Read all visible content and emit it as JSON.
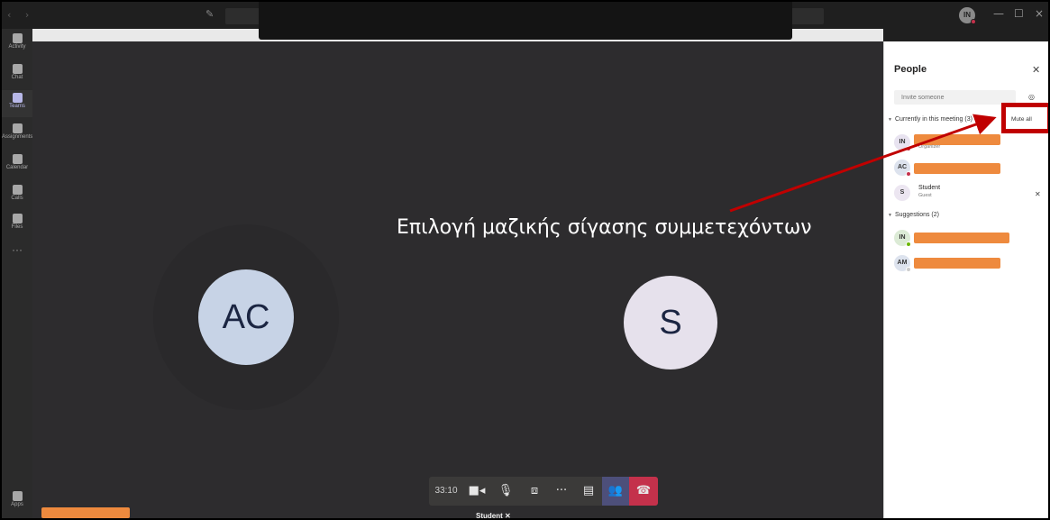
{
  "titlebar": {
    "nav_arrows": "‹ ›",
    "avatar_initials": "IN",
    "window_controls": {
      "minimize": "—",
      "maximize": "☐",
      "close": "×"
    }
  },
  "rail": {
    "items": [
      {
        "label": "Activity"
      },
      {
        "label": "Chat"
      },
      {
        "label": "Teams"
      },
      {
        "label": "Assignments"
      },
      {
        "label": "Calendar"
      },
      {
        "label": "Calls"
      },
      {
        "label": "Files"
      }
    ],
    "more": "···",
    "apps": "Apps"
  },
  "stage": {
    "tiles": [
      {
        "initials": "AC"
      },
      {
        "initials": "S"
      }
    ],
    "annotation": "Επιλογή μαζικής σίγασης συμμετεχόντων"
  },
  "controls": {
    "timer": "33:10",
    "icons": [
      "camera-icon",
      "microphone-icon",
      "share-screen-icon",
      "more-icon",
      "chat-icon",
      "participants-icon",
      "hang-up-icon"
    ],
    "self_label": "Student"
  },
  "people_panel": {
    "title": "People",
    "invite_placeholder": "Invite someone",
    "current_section": "Currently in this meeting (3)",
    "mute_all": "Mute all",
    "participants": [
      {
        "initials": "IN",
        "role": "Organizer",
        "status_color": "#c4314b"
      },
      {
        "initials": "AC",
        "role": "",
        "status_color": "#c4314b"
      },
      {
        "initials": "S",
        "name": "Student",
        "role": "Guest"
      }
    ],
    "suggestions_section": "Suggestions (2)",
    "suggestions": [
      {
        "initials": "IN",
        "status_color": "#6bb700"
      },
      {
        "initials": "AM",
        "status_color": "#aaaaaa"
      }
    ]
  },
  "colors": {
    "accent": "#4d4f7a",
    "hangup": "#c4314b",
    "redaction": "#ee8a3e",
    "highlight": "#c00000"
  }
}
